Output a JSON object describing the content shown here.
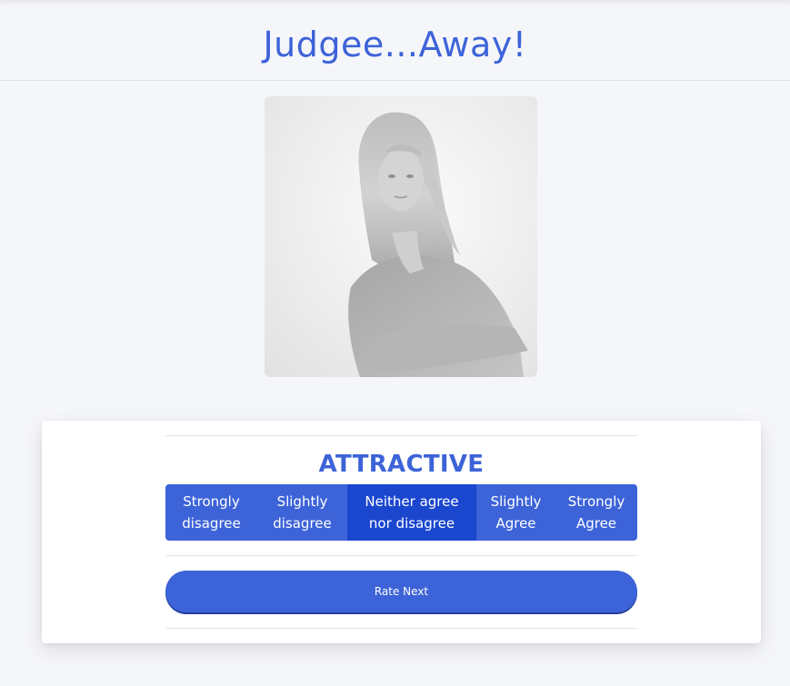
{
  "app": {
    "title": "Judgee...Away!"
  },
  "question": {
    "label": "ATTRACTIVE"
  },
  "scale": {
    "options": [
      {
        "line1": "Strongly",
        "line2": "disagree"
      },
      {
        "line1": "Slightly",
        "line2": "disagree"
      },
      {
        "line1": "Neither agree",
        "line2": "nor disagree"
      },
      {
        "line1": "Slightly",
        "line2": "Agree"
      },
      {
        "line1": "Strongly",
        "line2": "Agree"
      }
    ],
    "selected_index": 2
  },
  "actions": {
    "next_label": "Rate Next"
  },
  "colors": {
    "accent": "#3d63d8",
    "accent_selected": "#1b47cf",
    "page_background": "#f5f6fa",
    "card_background": "#ffffff"
  }
}
